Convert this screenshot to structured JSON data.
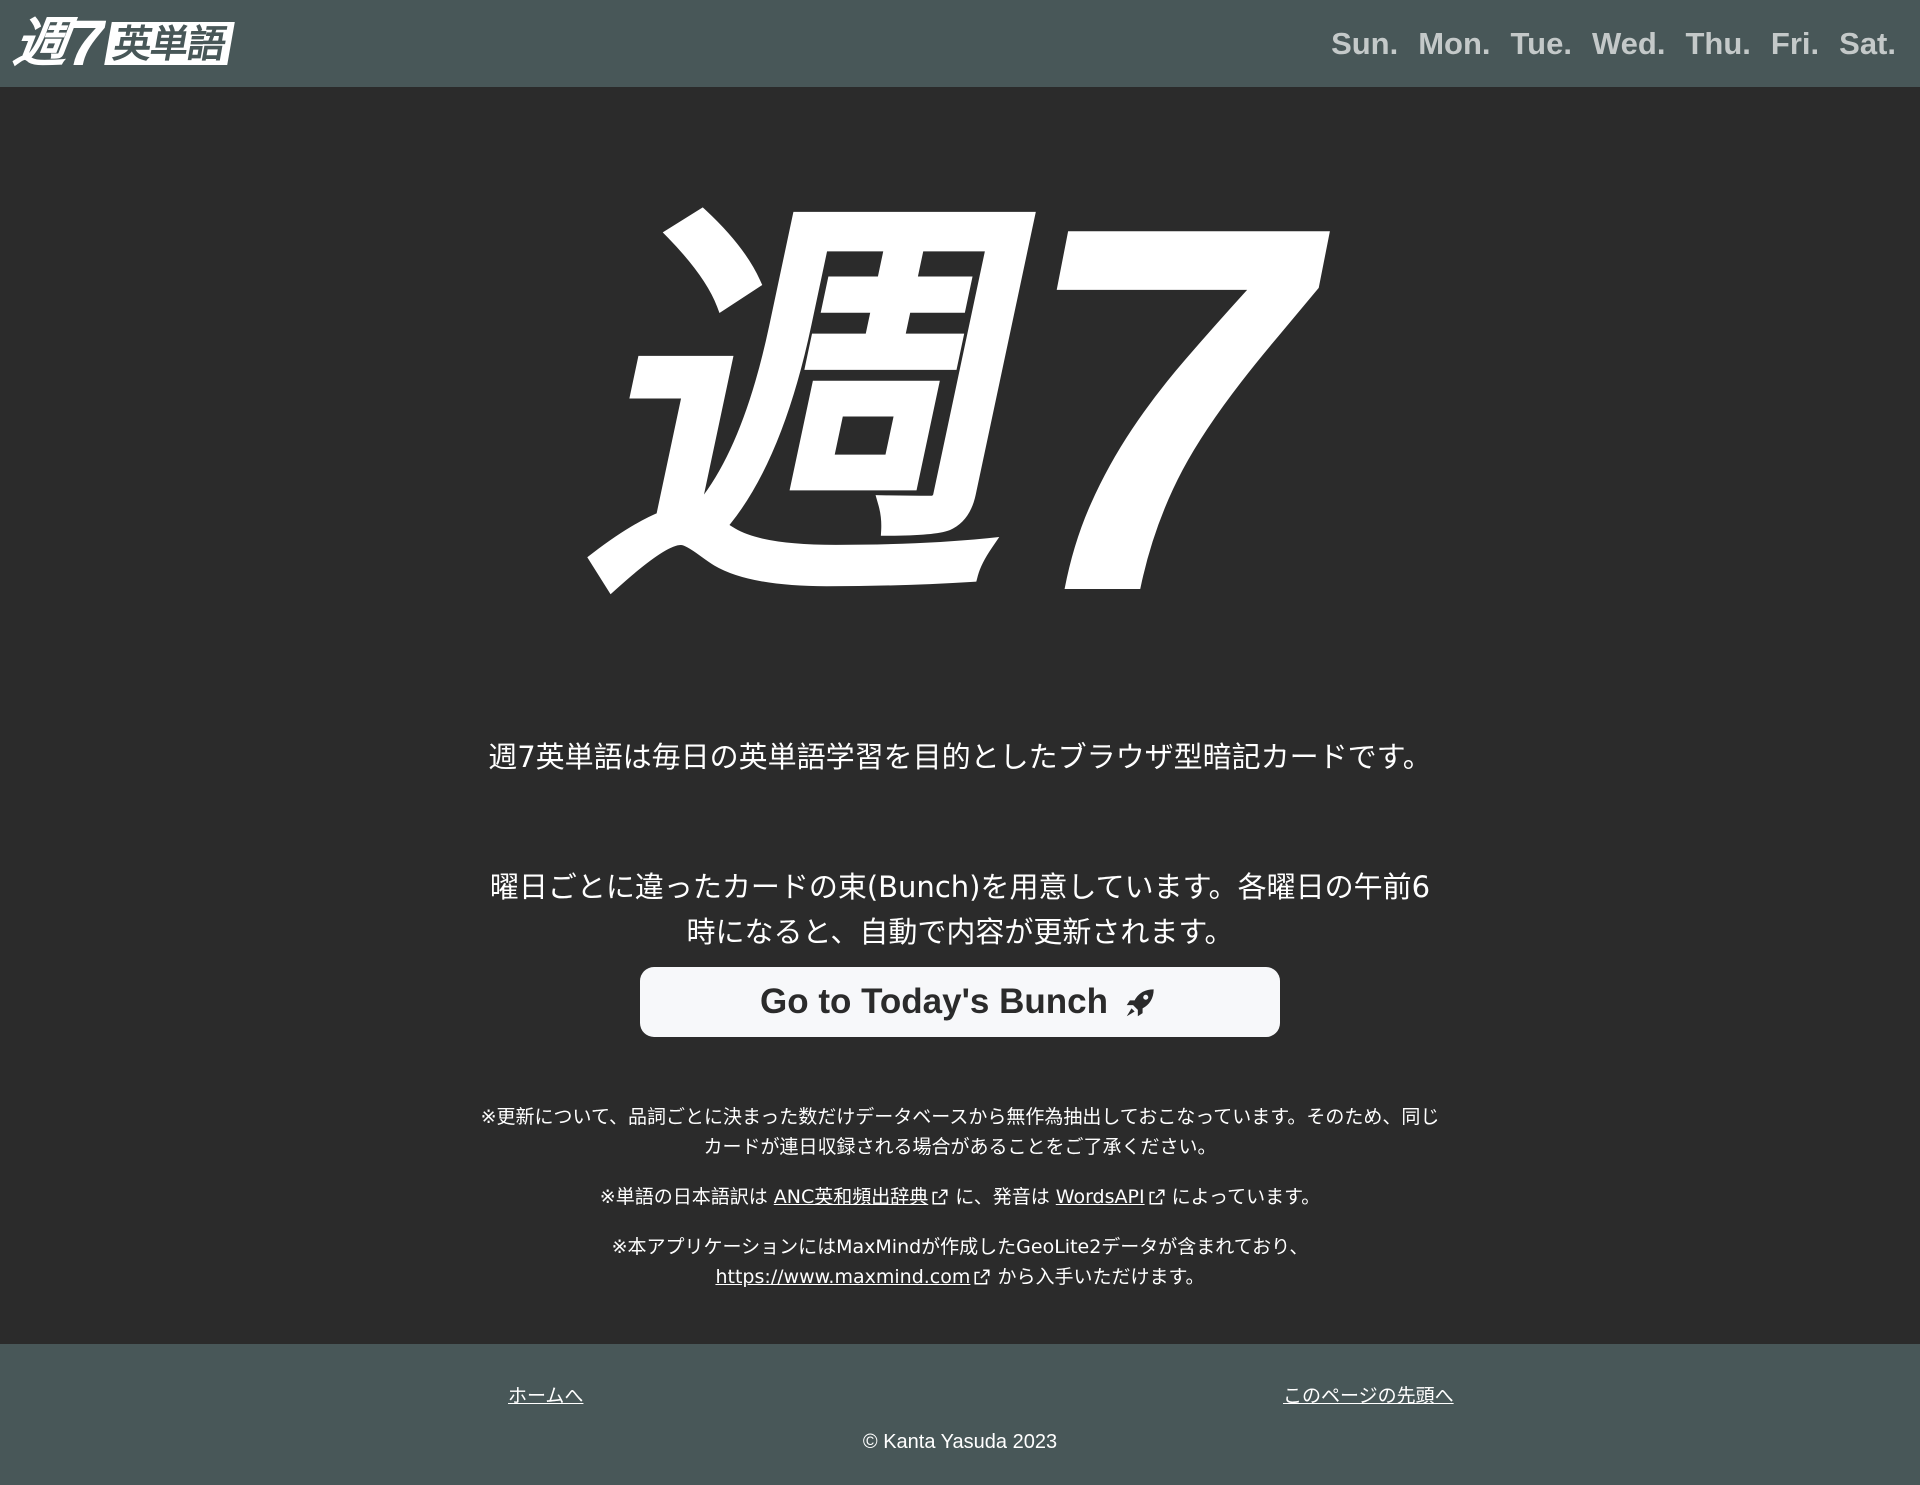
{
  "header": {
    "logo": {
      "kanji": "週",
      "seven": "7",
      "boxed": "英単語"
    },
    "days": [
      "Sun.",
      "Mon.",
      "Tue.",
      "Wed.",
      "Thu.",
      "Fri.",
      "Sat."
    ]
  },
  "hero": {
    "kanji": "週",
    "seven": "7"
  },
  "intro": {
    "p1": "週7英単語は毎日の英単語学習を目的としたブラウザ型暗記カードです。",
    "p2": "曜日ごとに違ったカードの束(Bunch)を用意しています。各曜日の午前6時になると、自動で内容が更新されます。"
  },
  "cta": {
    "label": "Go to Today's Bunch",
    "icon": "rocket-icon"
  },
  "notes": {
    "note1": "※更新について、品詞ごとに決まった数だけデータベースから無作為抽出しておこなっています。そのため、同じカードが連日収録される場合があることをご了承ください。",
    "note2_prefix": "※単語の日本語訳は",
    "note2_link1": "ANC英和頻出辞典",
    "note2_mid": "に、発音は",
    "note2_link2": "WordsAPI",
    "note2_suffix": "によっています。",
    "note3_line1": "※本アプリケーションにはMaxMindが作成したGeoLite2データが含まれており、",
    "note3_link": "https://www.maxmind.com",
    "note3_suffix": "から入手いただけます。"
  },
  "footer": {
    "home": "ホームへ",
    "top": "このページの先頭へ",
    "copyright": "© Kanta Yasuda 2023"
  },
  "colors": {
    "header_bg": "#485758",
    "body_bg": "#2b2b2b",
    "button_bg": "#f7f8fa",
    "day_text": "#c4c9c9"
  }
}
